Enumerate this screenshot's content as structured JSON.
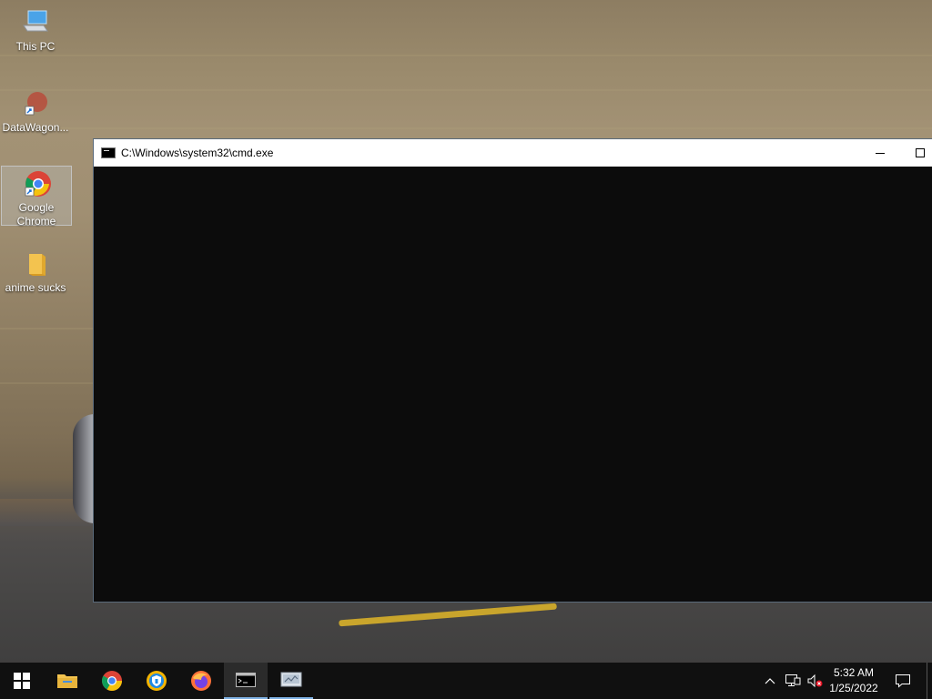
{
  "desktop": {
    "icons": [
      {
        "label": "This PC",
        "icon": "this-pc-icon"
      },
      {
        "label": "DataWagon...",
        "icon": "datawagon-shortcut-icon"
      },
      {
        "label": "Google Chrome",
        "icon": "chrome-icon"
      },
      {
        "label": "anime sucks",
        "icon": "folder-icon"
      }
    ]
  },
  "window": {
    "title": "C:\\Windows\\system32\\cmd.exe",
    "buttons": [
      "minimize",
      "maximize"
    ]
  },
  "taskbar": {
    "items": [
      {
        "name": "start",
        "icon": "windows-logo-icon"
      },
      {
        "name": "file-explorer",
        "icon": "folder-icon"
      },
      {
        "name": "chrome",
        "icon": "chrome-icon"
      },
      {
        "name": "brave-or-vpn",
        "icon": "shield-browser-icon"
      },
      {
        "name": "firefox",
        "icon": "firefox-icon"
      },
      {
        "name": "cmd",
        "icon": "cmd-icon",
        "active": true
      },
      {
        "name": "network-tool",
        "icon": "network-app-icon"
      }
    ],
    "tray": {
      "time": "5:32 AM",
      "date": "1/25/2022"
    }
  },
  "colors": {
    "taskbar": "#101010",
    "console": "#0c0c0c",
    "accent": "#7fb2e5"
  }
}
